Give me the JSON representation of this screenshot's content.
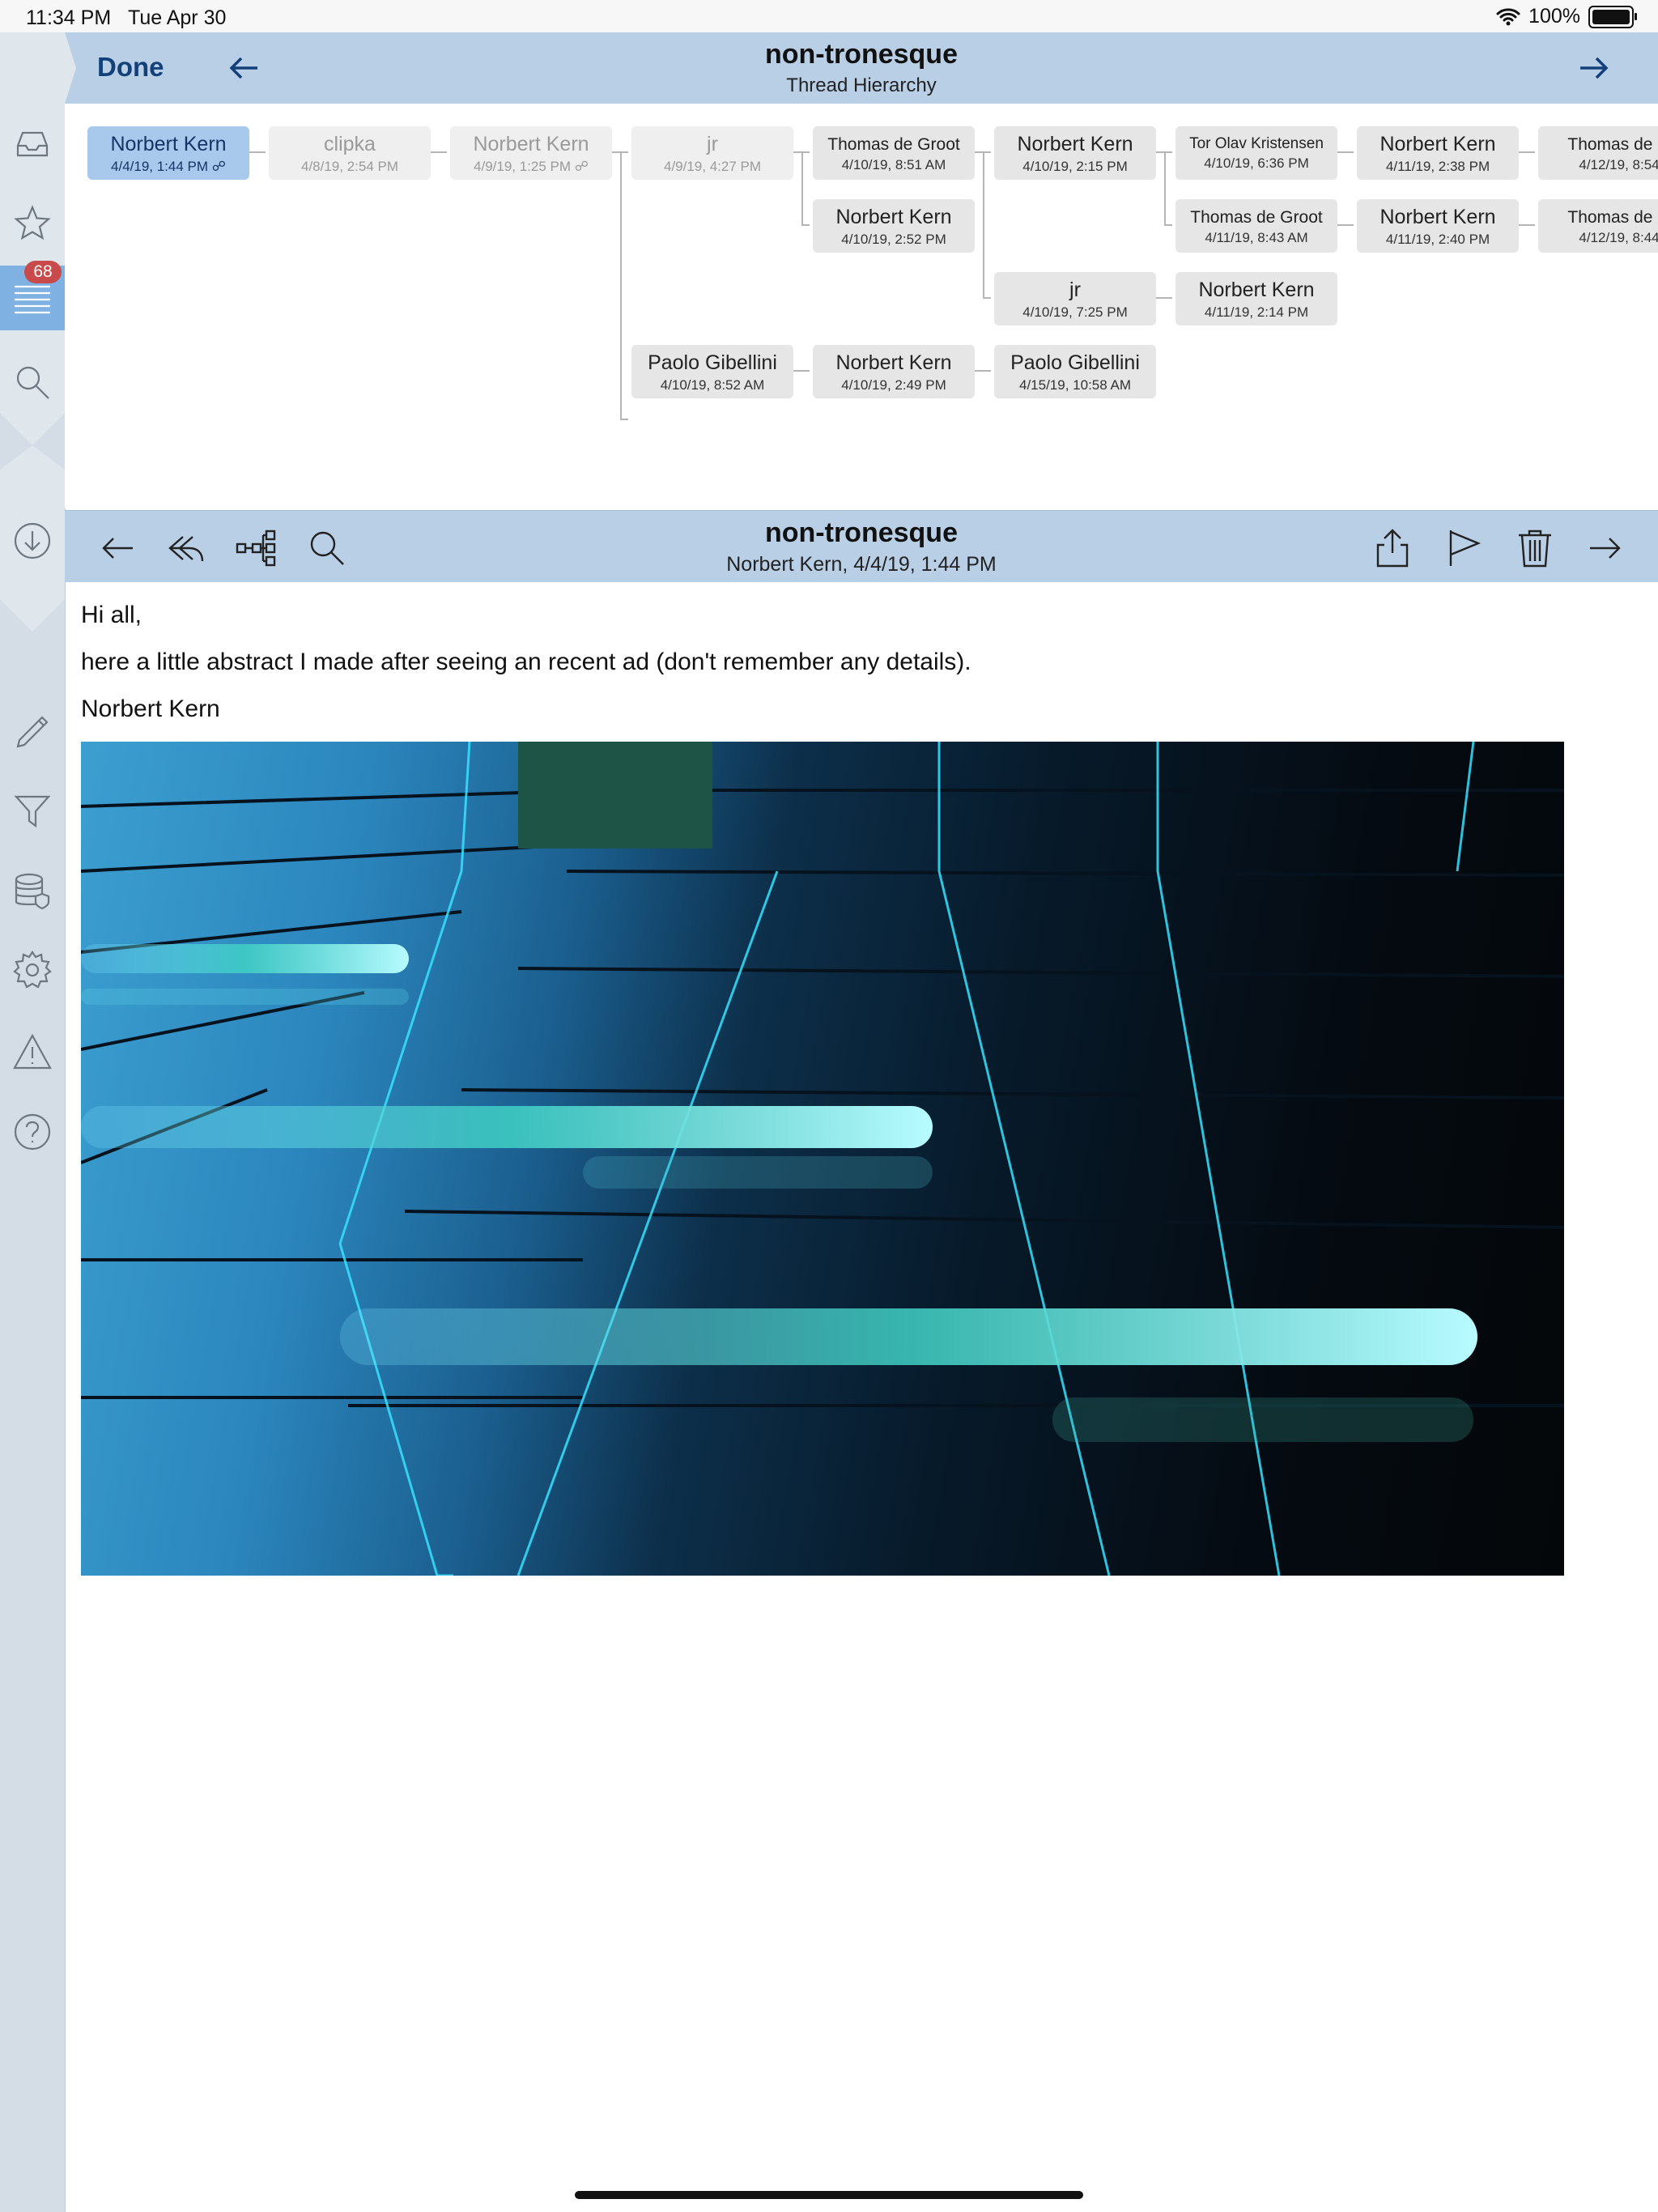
{
  "status": {
    "time": "11:34 PM",
    "date": "Tue Apr 30",
    "battery": "100%"
  },
  "sidebar": {
    "badge": "68"
  },
  "topbar": {
    "done": "Done",
    "title": "non-tronesque",
    "subtitle": "Thread Hierarchy"
  },
  "tree": [
    {
      "name": "Norbert Kern",
      "date": "4/4/19, 1:44 PM ☍"
    },
    {
      "name": "clipka",
      "date": "4/8/19, 2:54 PM"
    },
    {
      "name": "Norbert Kern",
      "date": "4/9/19, 1:25 PM ☍"
    },
    {
      "name": "jr",
      "date": "4/9/19, 4:27 PM"
    },
    {
      "name": "Thomas de Groot",
      "date": "4/10/19, 8:51 AM"
    },
    {
      "name": "Norbert Kern",
      "date": "4/10/19, 2:15 PM"
    },
    {
      "name": "Tor Olav Kristensen",
      "date": "4/10/19, 6:36 PM"
    },
    {
      "name": "Norbert Kern",
      "date": "4/11/19, 2:38 PM"
    },
    {
      "name": "Thomas de G",
      "date": "4/12/19, 8:54"
    },
    {
      "name": "Norbert Kern",
      "date": "4/10/19, 2:52 PM"
    },
    {
      "name": "Thomas de Groot",
      "date": "4/11/19, 8:43 AM"
    },
    {
      "name": "Norbert Kern",
      "date": "4/11/19, 2:40 PM"
    },
    {
      "name": "Thomas de G",
      "date": "4/12/19, 8:44"
    },
    {
      "name": "jr",
      "date": "4/10/19, 7:25 PM"
    },
    {
      "name": "Norbert Kern",
      "date": "4/11/19, 2:14 PM"
    },
    {
      "name": "Paolo Gibellini",
      "date": "4/10/19, 8:52 AM"
    },
    {
      "name": "Norbert Kern",
      "date": "4/10/19, 2:49 PM"
    },
    {
      "name": "Paolo Gibellini",
      "date": "4/15/19, 10:58 AM"
    }
  ],
  "message": {
    "title": "non-tronesque",
    "meta": "Norbert Kern, 4/4/19, 1:44 PM",
    "lines": [
      "Hi all,",
      "here a little abstract I made after seeing an recent ad (don't remember any details).",
      "Norbert Kern"
    ]
  },
  "colors": {
    "header_bg": "#b9cfe6",
    "selected_node": "#a9c9ec",
    "badge": "#c94a4a",
    "accent": "#14407a"
  }
}
